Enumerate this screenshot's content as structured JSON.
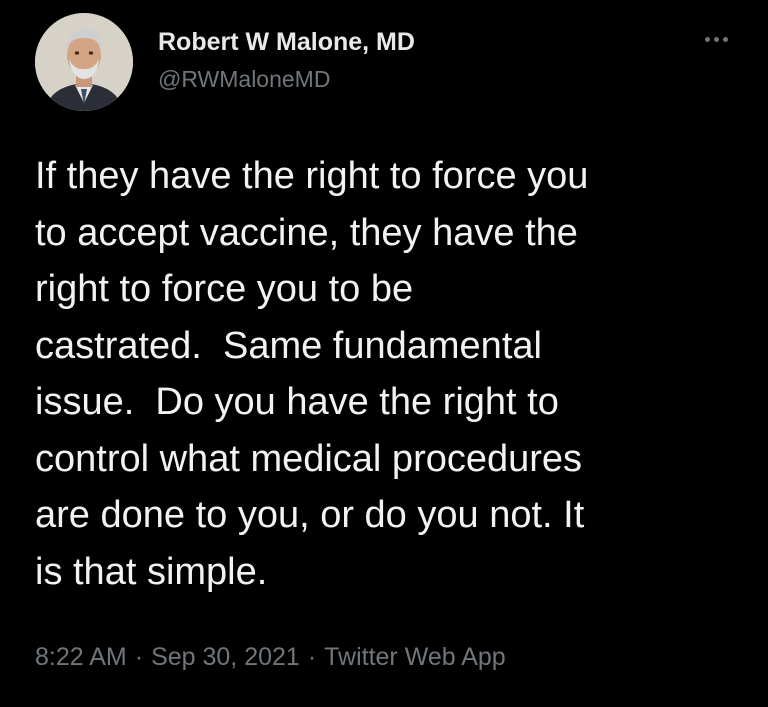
{
  "author": {
    "display_name": "Robert W Malone, MD",
    "handle": "@RWMaloneMD",
    "avatar_icon": "profile-photo"
  },
  "more_icon": "more-horizontal-icon",
  "tweet": {
    "lines": [
      "If they have the right to force you",
      "to accept vaccine, they have the",
      "right to force you to be",
      "castrated.  Same fundamental",
      "issue.  Do you have the right to",
      "control what medical procedures",
      "are done to you, or do you not. It",
      "is that simple."
    ]
  },
  "meta": {
    "time": "8:22 AM",
    "separator": "·",
    "date": "Sep 30, 2021",
    "source": "Twitter Web App"
  },
  "colors": {
    "background": "#000000",
    "primary_text": "#e7e9ea",
    "secondary_text": "#71767b"
  }
}
